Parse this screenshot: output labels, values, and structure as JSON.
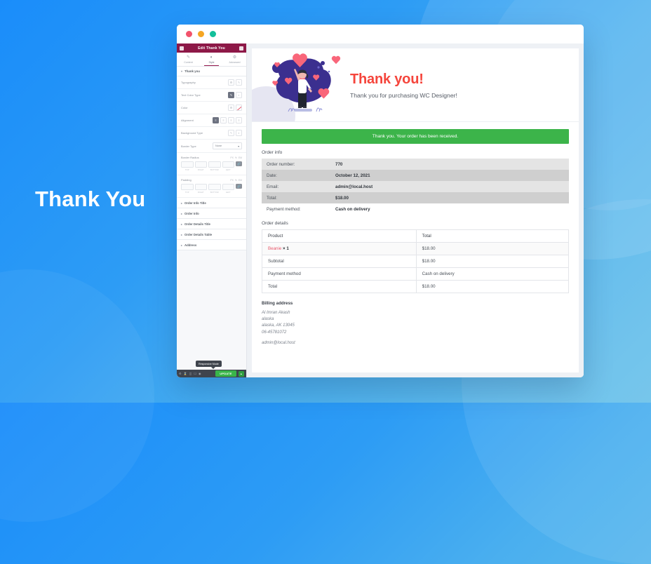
{
  "background": {
    "left_title": "Thank You",
    "gradient_from": "#1a8dfa",
    "gradient_to": "#6cc2ea"
  },
  "window": {
    "traffic_lights": [
      "close-dot",
      "minimize-dot",
      "maximize-dot"
    ]
  },
  "sidebar": {
    "header_title": "Edit Thank You",
    "menu_icon": "hamburger-icon",
    "grid_icon": "grid-icon",
    "tabs": [
      {
        "label": "Content",
        "icon": "pencil-icon",
        "glyph": "✎",
        "active": false
      },
      {
        "label": "Style",
        "icon": "contrast-circle-icon",
        "glyph": "◐",
        "active": true
      },
      {
        "label": "Advanced",
        "icon": "gear-icon",
        "glyph": "⚙",
        "active": false
      }
    ],
    "section_title": "Thank you",
    "controls": [
      {
        "label": "Typography",
        "type": "icons",
        "icons": [
          "gear-icon",
          "pencil-icon"
        ]
      },
      {
        "label": "Text Color Type",
        "type": "toggle",
        "icons": [
          "pencil-icon",
          "swatch-icon"
        ]
      },
      {
        "label": "Color",
        "type": "color",
        "icons": [
          "gear-icon",
          "color-line-icon"
        ]
      },
      {
        "label": "Alignment",
        "type": "align",
        "icons": [
          "align-left-icon",
          "align-center-icon",
          "align-right-icon",
          "align-justify-icon"
        ]
      },
      {
        "label": "Background Type",
        "type": "toggle",
        "icons": [
          "brush-icon",
          "gradient-icon"
        ]
      }
    ],
    "border_type": {
      "label": "Border Type",
      "value": "None"
    },
    "border_radius": {
      "label": "Border Radius",
      "unit": "PX",
      "unit_alt": "%",
      "unit_em": "EM",
      "fields": [
        "",
        "",
        "",
        ""
      ],
      "captions": [
        "TOP",
        "RIGHT",
        "BOTTOM",
        "LEFT"
      ],
      "link_icon": "link-icon"
    },
    "padding": {
      "label": "Padding",
      "unit": "PX",
      "unit_alt": "%",
      "unit_em": "EM",
      "fields": [
        "",
        "",
        "",
        ""
      ],
      "captions": [
        "TOP",
        "RIGHT",
        "BOTTOM",
        "LEFT"
      ],
      "link_icon": "link-icon"
    },
    "accordions": [
      {
        "label": "Order Info Title"
      },
      {
        "label": "Order Info"
      },
      {
        "label": "Order Details Title"
      },
      {
        "label": "Order Details Table"
      },
      {
        "label": "Address"
      }
    ],
    "tooltip": "Responsive Mode",
    "footer": {
      "icons": [
        "settings-icon",
        "history-icon",
        "responsive-icon",
        "preview-icon",
        "more-icon"
      ],
      "update_label": "UPDATE",
      "update_caret": "▲",
      "update_color": "#39b54a"
    }
  },
  "preview": {
    "hero": {
      "heading": "Thank you!",
      "heading_color": "#f5453c",
      "subheading": "Thank you for purchasing WC Designer!",
      "illustration": "thank-you-hearts-illustration"
    },
    "notice": {
      "text": "Thank you. Your order has been received.",
      "color": "#3cb44a"
    },
    "order_info": {
      "title": "Order info",
      "rows": [
        {
          "key": "Order number:",
          "value": "770"
        },
        {
          "key": "Date:",
          "value": "October 12, 2021"
        },
        {
          "key": "Email:",
          "value": "admin@local.host"
        },
        {
          "key": "Total:",
          "value": "$18.00"
        },
        {
          "key": "Payment method:",
          "value": "Cash on delivery"
        }
      ]
    },
    "order_details": {
      "title": "Order details",
      "columns": [
        "Product",
        "Total"
      ],
      "item": {
        "product": "Beanie",
        "qty": "× 1",
        "total": "$18.00"
      },
      "rows": [
        {
          "label": "Subtotal",
          "value": "$18.00"
        },
        {
          "label": "Payment method",
          "value": "Cash on delivery"
        },
        {
          "label": "Total",
          "value": "$18.00"
        }
      ]
    },
    "billing": {
      "title": "Billing address",
      "lines": [
        "Al Imran Akash",
        "alaska",
        "alaska, AK 13045",
        "06-45781072"
      ],
      "email": "admin@local.host"
    }
  }
}
